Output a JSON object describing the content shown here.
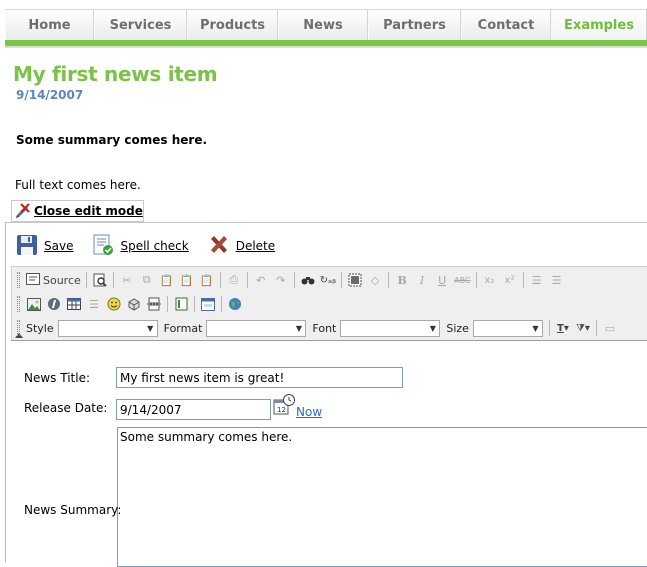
{
  "nav": {
    "tabs": [
      "Home",
      "Services",
      "Products",
      "News",
      "Partners",
      "Contact",
      "Examples"
    ],
    "active": "Examples",
    "accent": "#7ec34a"
  },
  "news": {
    "title": "My first news item",
    "date": "9/14/2007",
    "summary": "Some summary comes here.",
    "fulltext": "Full text comes here."
  },
  "edit": {
    "close_label": "Close edit mode",
    "save_label": "Save",
    "spellcheck_label": "Spell check",
    "delete_label": "Delete"
  },
  "toolbar": {
    "source_label": "Source",
    "bold_label": "B",
    "italic_label": "I",
    "underline_label": "U",
    "strike_label": "ABC",
    "style_label": "Style",
    "format_label": "Format",
    "font_label": "Font",
    "size_label": "Size",
    "style_value": "",
    "format_value": "",
    "font_value": "",
    "size_value": ""
  },
  "form": {
    "title_label": "News Title:",
    "title_value": "My first news item is great!",
    "date_label": "Release Date:",
    "date_value": "9/14/2007",
    "now_label": "Now",
    "summary_label": "News Summary:",
    "summary_value": "Some summary comes here."
  }
}
